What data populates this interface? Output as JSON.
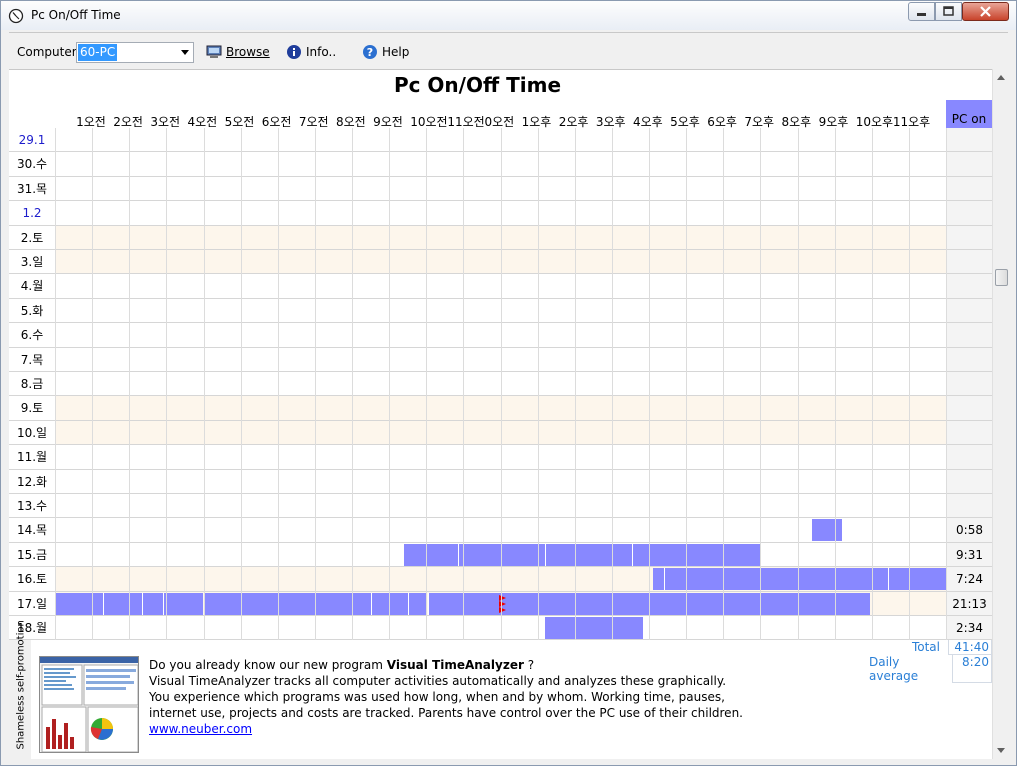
{
  "window": {
    "title": "Pc On/Off Time"
  },
  "toolbar": {
    "computer_label": "Computer",
    "computer_value": "60-PC",
    "browse_label": "Browse",
    "info_label": "Info..",
    "help_label": "Help"
  },
  "page_title": "Pc On/Off Time",
  "hours": [
    "1오전",
    "2오전",
    "3오전",
    "4오전",
    "5오전",
    "6오전",
    "7오전",
    "8오전",
    "9오전",
    "10오전",
    "11오전",
    "0오전",
    "1오후",
    "2오후",
    "3오후",
    "4오후",
    "5오후",
    "6오후",
    "7오후",
    "8오후",
    "9오후",
    "10오후",
    "11오후"
  ],
  "pc_on_header": "PC on",
  "rows": [
    {
      "date": "29.1",
      "style": "blue",
      "weekend": false,
      "pcon": "",
      "bars": []
    },
    {
      "date": "30.수",
      "style": "",
      "weekend": false,
      "pcon": "",
      "bars": []
    },
    {
      "date": "31.목",
      "style": "",
      "weekend": false,
      "pcon": "",
      "bars": []
    },
    {
      "date": "1.2",
      "style": "blue",
      "weekend": false,
      "pcon": "",
      "bars": []
    },
    {
      "date": "2.토",
      "style": "",
      "weekend": true,
      "pcon": "",
      "bars": []
    },
    {
      "date": "3.일",
      "style": "",
      "weekend": true,
      "pcon": "",
      "bars": []
    },
    {
      "date": "4.월",
      "style": "",
      "weekend": false,
      "pcon": "",
      "bars": []
    },
    {
      "date": "5.화",
      "style": "",
      "weekend": false,
      "pcon": "",
      "bars": []
    },
    {
      "date": "6.수",
      "style": "",
      "weekend": false,
      "pcon": "",
      "bars": []
    },
    {
      "date": "7.목",
      "style": "",
      "weekend": false,
      "pcon": "",
      "bars": []
    },
    {
      "date": "8.금",
      "style": "",
      "weekend": false,
      "pcon": "",
      "bars": []
    },
    {
      "date": "9.토",
      "style": "",
      "weekend": true,
      "pcon": "",
      "bars": []
    },
    {
      "date": "10.일",
      "style": "",
      "weekend": true,
      "pcon": "",
      "bars": []
    },
    {
      "date": "11.월",
      "style": "",
      "weekend": false,
      "pcon": "",
      "bars": []
    },
    {
      "date": "12.화",
      "style": "",
      "weekend": false,
      "pcon": "",
      "bars": []
    },
    {
      "date": "13.수",
      "style": "",
      "weekend": false,
      "pcon": "",
      "bars": []
    },
    {
      "date": "14.목",
      "style": "",
      "weekend": false,
      "pcon": "0:58",
      "bars": [
        [
          20.4,
          21.2
        ]
      ]
    },
    {
      "date": "15.금",
      "style": "",
      "weekend": false,
      "pcon": "9:31",
      "bars": [
        [
          9.4,
          10.85
        ],
        [
          10.85,
          13.2
        ],
        [
          13.2,
          15.55
        ],
        [
          15.55,
          19.0
        ]
      ]
    },
    {
      "date": "16.토",
      "style": "",
      "weekend": true,
      "pcon": "7:24",
      "bars": [
        [
          16.1,
          16.4
        ],
        [
          16.4,
          22.45
        ],
        [
          22.45,
          24
        ]
      ]
    },
    {
      "date": "17.일",
      "style": "",
      "weekend": true,
      "pcon": "21:13",
      "bars": [
        [
          0,
          1.3
        ],
        [
          1.3,
          2.35
        ],
        [
          2.35,
          2.9
        ],
        [
          2.9,
          4.0
        ],
        [
          4.0,
          6.0
        ],
        [
          6.0,
          8.0
        ],
        [
          8.0,
          8.5
        ],
        [
          8.5,
          9.0
        ],
        [
          9.0,
          9.5
        ],
        [
          9.5,
          10.0
        ],
        [
          10.05,
          21.95
        ]
      ]
    },
    {
      "date": "18.월",
      "style": "",
      "weekend": false,
      "pcon": "2:34",
      "bars": [
        [
          13.2,
          15.85
        ]
      ]
    }
  ],
  "totals": {
    "total_label": "Total",
    "total_value": "41:40",
    "avg_label": "Daily average",
    "avg_value": "8:20"
  },
  "promo": {
    "side_label": "Shameless self-promotion",
    "headline_prefix": "Do you already know our new program ",
    "headline_bold": "Visual TimeAnalyzer",
    "headline_suffix": " ?",
    "line2": "Visual TimeAnalyzer tracks all computer activities automatically and analyzes these graphically.",
    "line3": "You experience which programs was used how long, when and by whom. Working time, pauses,",
    "line4": "internet use, projects and costs are tracked. Parents have control over the PC use of their children.",
    "link": "www.neuber.com"
  }
}
